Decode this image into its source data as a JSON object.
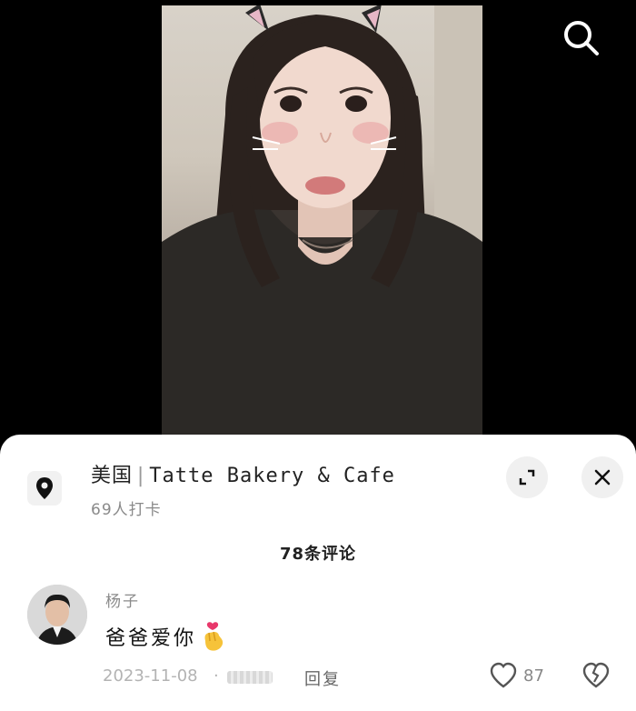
{
  "location": {
    "country": "美国",
    "separator": "|",
    "place": "Tatte Bakery & Cafe",
    "checkins": "69人打卡"
  },
  "comments_header": "78条评论",
  "comment": {
    "username": "杨子",
    "text": "爸爸爱你",
    "date": "2023-11-08",
    "dot": "·",
    "reply_label": "回复",
    "like_count": "87"
  },
  "icons": {
    "search": "search-icon",
    "location": "location-pin-icon",
    "expand": "expand-icon",
    "close": "close-icon",
    "heart": "heart-icon",
    "broken_heart": "broken-heart-icon",
    "emoji": "finger-heart-emoji"
  },
  "colors": {
    "background": "#000000",
    "sheet": "#ffffff",
    "text_primary": "#222222",
    "text_secondary": "#8a8a8a"
  }
}
